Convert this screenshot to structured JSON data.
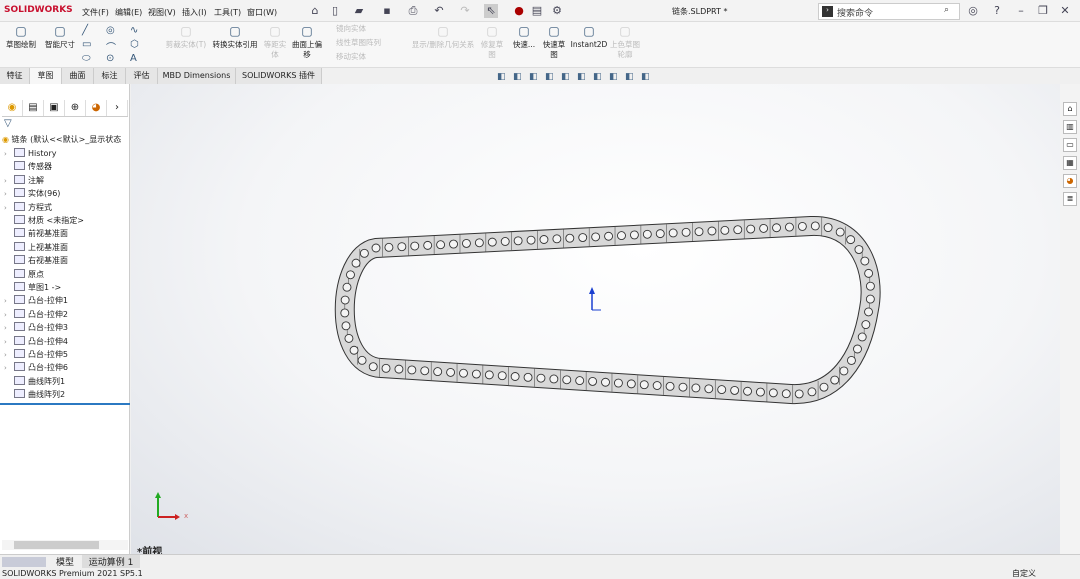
{
  "app": {
    "logo": "SOLIDWORKS",
    "title": "链条.SLDPRT *"
  },
  "menu": [
    "文件(F)",
    "编辑(E)",
    "视图(V)",
    "插入(I)",
    "工具(T)",
    "窗口(W)"
  ],
  "search": {
    "placeholder": "搜索命令"
  },
  "ribbon": [
    {
      "label": "草图绘制",
      "icon": "sketch-icon",
      "enabled": true
    },
    {
      "label": "智能尺寸",
      "icon": "smart-dimension-icon",
      "enabled": true
    },
    {
      "label": "剪裁实体(T)",
      "icon": "trim-icon",
      "enabled": false
    },
    {
      "label": "转换实体引用",
      "icon": "convert-entities-icon",
      "enabled": true
    },
    {
      "label": "等距实体",
      "icon": "offset-entities-icon",
      "enabled": false
    },
    {
      "label": "曲面上偏移",
      "icon": "offset-on-surface-icon",
      "enabled": true
    },
    {
      "label": "镜向实体",
      "icon": "mirror-icon",
      "enabled": false
    },
    {
      "label": "线性草图阵列",
      "icon": "linear-pattern-icon",
      "enabled": false
    },
    {
      "label": "移动实体",
      "icon": "move-icon",
      "enabled": false
    },
    {
      "label": "显示/删除几何关系",
      "icon": "relations-icon",
      "enabled": false
    },
    {
      "label": "修复草图",
      "icon": "repair-sketch-icon",
      "enabled": false
    },
    {
      "label": "快速...",
      "icon": "quick-snaps-icon",
      "enabled": true
    },
    {
      "label": "快速草图",
      "icon": "rapid-sketch-icon",
      "enabled": true
    },
    {
      "label": "Instant2D",
      "icon": "instant2d-icon",
      "enabled": true
    },
    {
      "label": "上色草图轮廓",
      "icon": "shaded-sketch-icon",
      "enabled": false
    }
  ],
  "tabs": [
    "特征",
    "草图",
    "曲面",
    "标注",
    "评估",
    "MBD Dimensions",
    "SOLIDWORKS 插件"
  ],
  "active_tab": "草图",
  "tree": {
    "root": "链条 (默认<<默认>_显示状态",
    "items": [
      {
        "label": "History",
        "expandable": true
      },
      {
        "label": "传感器",
        "expandable": false
      },
      {
        "label": "注解",
        "expandable": true
      },
      {
        "label": "实体(96)",
        "expandable": true
      },
      {
        "label": "方程式",
        "expandable": true
      },
      {
        "label": "材质 <未指定>",
        "expandable": false
      },
      {
        "label": "前视基准面",
        "expandable": false
      },
      {
        "label": "上视基准面",
        "expandable": false
      },
      {
        "label": "右视基准面",
        "expandable": false
      },
      {
        "label": "原点",
        "expandable": false
      },
      {
        "label": "草图1 ->",
        "expandable": false
      },
      {
        "label": "凸台-拉伸1",
        "expandable": true
      },
      {
        "label": "凸台-拉伸2",
        "expandable": true
      },
      {
        "label": "凸台-拉伸3",
        "expandable": true
      },
      {
        "label": "凸台-拉伸4",
        "expandable": true
      },
      {
        "label": "凸台-拉伸5",
        "expandable": true
      },
      {
        "label": "凸台-拉伸6",
        "expandable": true
      },
      {
        "label": "曲线阵列1",
        "expandable": false
      },
      {
        "label": "曲线阵列2",
        "expandable": false
      }
    ]
  },
  "viewport": {
    "view_name": "*前视",
    "axis_x": "x"
  },
  "bottom_tabs": [
    "模型",
    "运动算例 1"
  ],
  "status": {
    "left": "SOLIDWORKS Premium 2021 SP5.1",
    "right": "自定义"
  }
}
